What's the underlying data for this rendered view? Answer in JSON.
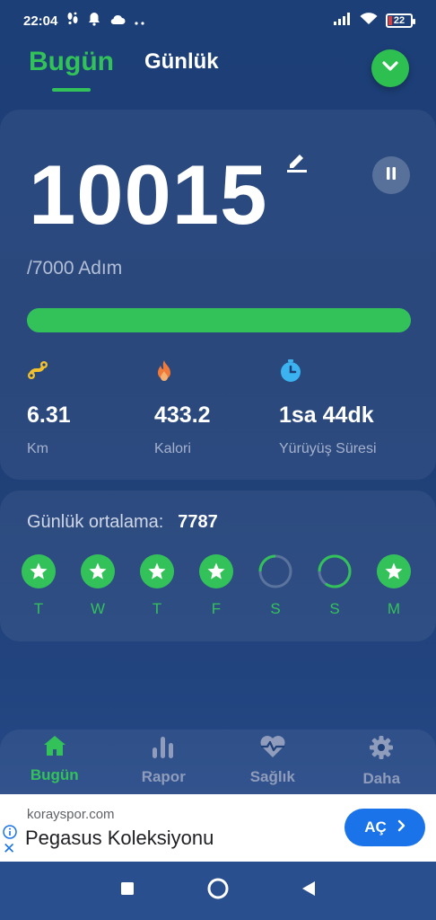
{
  "status_bar": {
    "time": "22:04",
    "notif_icons": [
      "steps-icon",
      "bell-icon",
      "cloud-icon",
      "more-dots-icon"
    ],
    "battery": "22"
  },
  "top_tabs": [
    {
      "label": "Bugün",
      "active": true
    },
    {
      "label": "Günlük",
      "active": false
    }
  ],
  "summary": {
    "steps": "10015",
    "goal": "/7000 Adım",
    "progress_fraction": 1.0,
    "stats": [
      {
        "icon": "distance-icon",
        "value": "6.31",
        "label": "Km"
      },
      {
        "icon": "flame-icon",
        "value": "433.2",
        "label": "Kalori"
      },
      {
        "icon": "timer-icon",
        "value": "1sa 44dk",
        "label": "Yürüyüş Süresi"
      }
    ]
  },
  "weekly": {
    "avg_label": "Günlük ortalama:",
    "avg_value": "7787",
    "days": [
      {
        "label": "T",
        "status": "complete",
        "progress": 1.0
      },
      {
        "label": "W",
        "status": "complete",
        "progress": 1.0
      },
      {
        "label": "T",
        "status": "complete",
        "progress": 1.0
      },
      {
        "label": "F",
        "status": "complete",
        "progress": 1.0
      },
      {
        "label": "S",
        "status": "partial",
        "progress": 0.25
      },
      {
        "label": "S",
        "status": "partial",
        "progress": 0.85
      },
      {
        "label": "M",
        "status": "complete",
        "progress": 1.0
      }
    ]
  },
  "bottom_nav": [
    {
      "label": "Bugün",
      "icon": "home-icon",
      "active": true
    },
    {
      "label": "Rapor",
      "icon": "bar-chart-icon",
      "active": false
    },
    {
      "label": "Sağlık",
      "icon": "heart-pulse-icon",
      "active": false
    },
    {
      "label": "Daha",
      "icon": "gear-icon",
      "active": false
    }
  ],
  "ad": {
    "domain": "korayspor.com",
    "title": "Pegasus Koleksiyonu",
    "cta": "AÇ"
  },
  "colors": {
    "accent": "#33c25a",
    "background": "#1e3d74",
    "ad_button": "#1a73e8"
  }
}
